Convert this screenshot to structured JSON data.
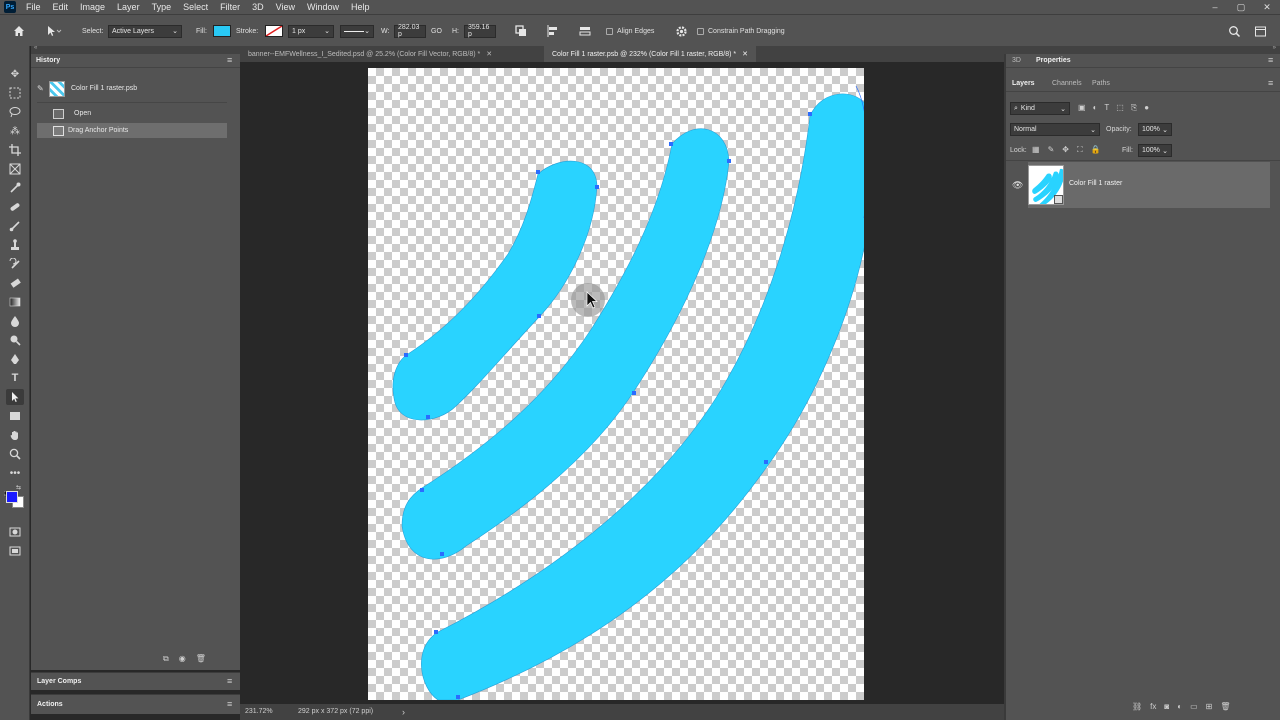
{
  "menu": {
    "logo": "Ps",
    "items": [
      "File",
      "Edit",
      "Image",
      "Layer",
      "Type",
      "Select",
      "Filter",
      "3D",
      "View",
      "Window",
      "Help"
    ],
    "window_controls": [
      "–",
      "▢",
      "✕"
    ]
  },
  "options": {
    "select_label": "Select:",
    "select_value": "Active Layers",
    "fill_label": "Fill:",
    "fill_color": "#29c9f5",
    "stroke_label": "Stroke:",
    "stroke_width": "1 px",
    "w_label": "W:",
    "w_value": "282.03 p",
    "go_label": "GO",
    "h_label": "H:",
    "h_value": "359.16 p",
    "align_edges": "Align Edges",
    "constrain": "Constrain Path Dragging"
  },
  "history": {
    "title": "History",
    "snapshot": "Color Fill 1 raster.psb",
    "items": [
      "Open",
      "Drag Anchor Points"
    ],
    "panels": [
      "Layer Comps",
      "Actions"
    ]
  },
  "tabs": [
    {
      "label": "banner--EMFWellness_I_Sedited.psd @ 25.2% (Color Fill Vector, RGB/8) *"
    },
    {
      "label": "Color Fill 1 raster.psb @ 232% (Color Fill 1 raster, RGB/8) *"
    }
  ],
  "status": {
    "zoom": "231.72%",
    "doc_size": "292 px x 372 px (72 ppi)",
    "arrow": "›"
  },
  "right": {
    "top_tabs": [
      "3D",
      "Properties"
    ],
    "layer_tabs": [
      "Layers",
      "Channels",
      "Paths"
    ],
    "kind": "Kind",
    "blend": "Normal",
    "opacity_label": "Opacity:",
    "opacity": "100%",
    "lock_label": "Lock:",
    "fill_label": "Fill:",
    "fill": "100%",
    "layer_name": "Color Fill 1 raster"
  },
  "colors": {
    "shape": "#29d3ff",
    "foreground": "#1a1aff",
    "anchor": "#2a6cff"
  }
}
